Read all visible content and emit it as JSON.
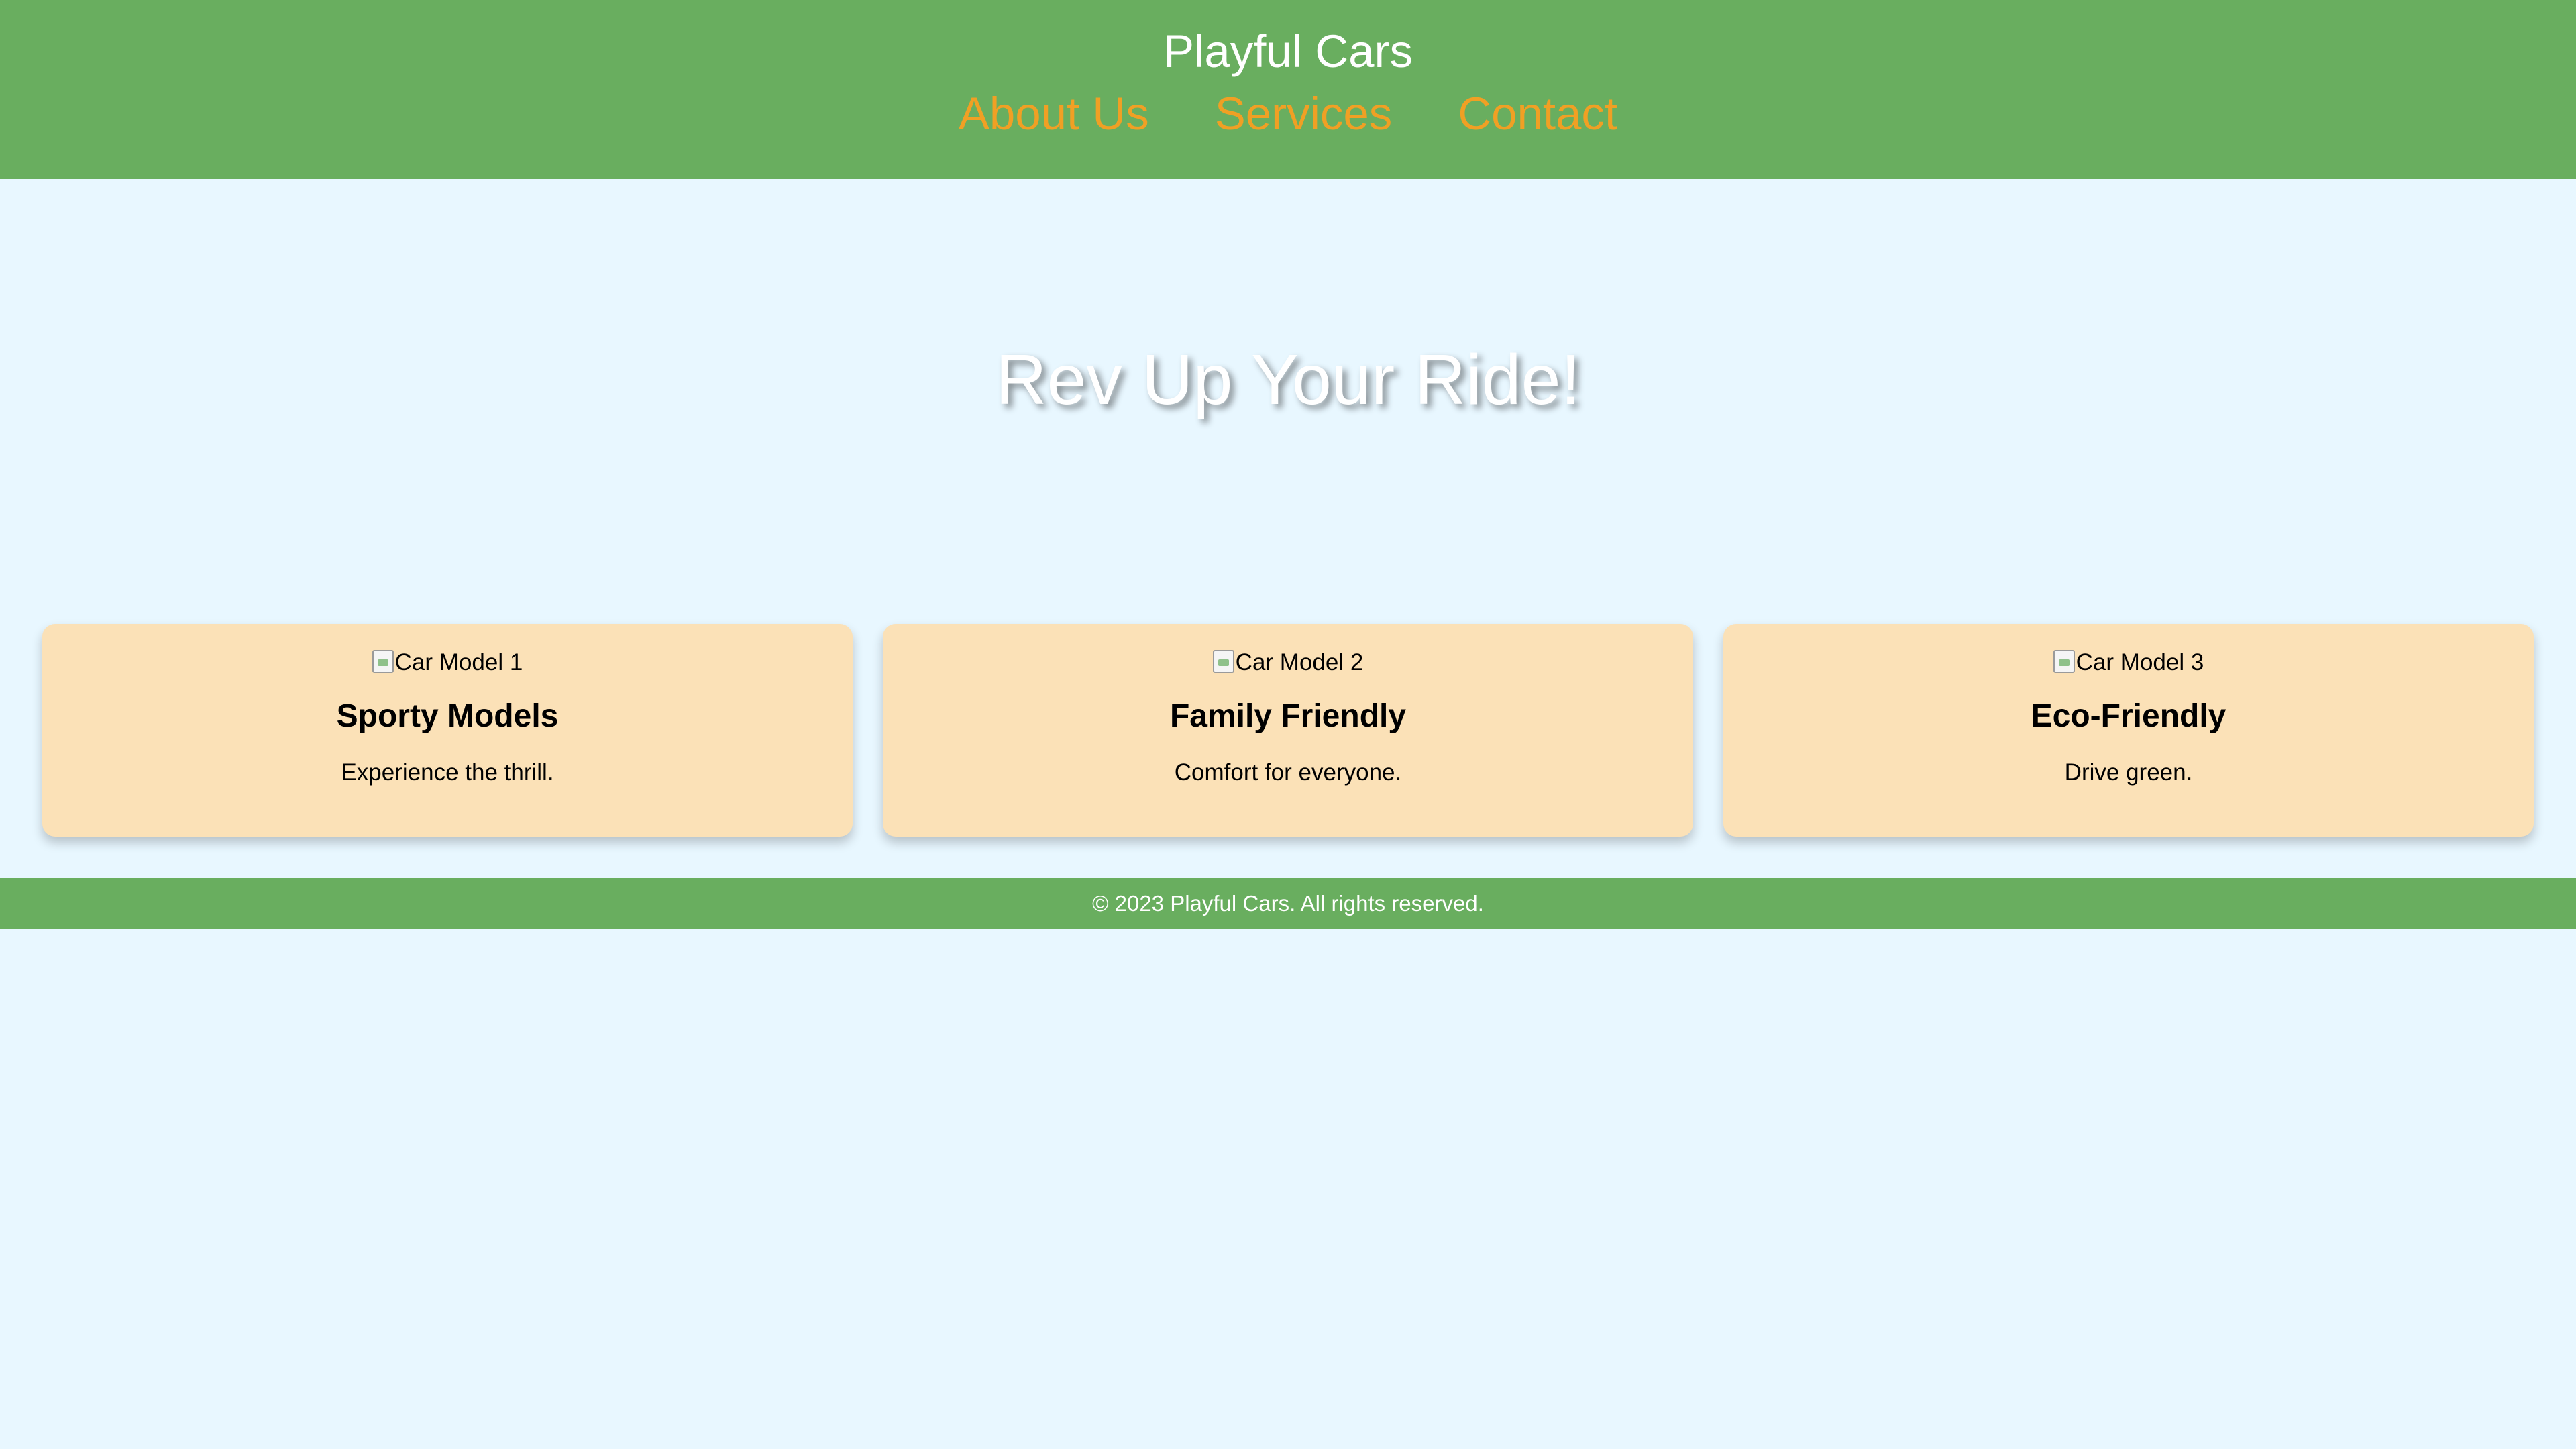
{
  "header": {
    "title": "Playful Cars",
    "nav": [
      {
        "label": "About Us"
      },
      {
        "label": "Services"
      },
      {
        "label": "Contact"
      }
    ]
  },
  "hero": {
    "title": "Rev Up Your Ride!"
  },
  "cards": [
    {
      "image_alt": "Car Model 1",
      "title": "Sporty Models",
      "description": "Experience the thrill."
    },
    {
      "image_alt": "Car Model 2",
      "title": "Family Friendly",
      "description": "Comfort for everyone."
    },
    {
      "image_alt": "Car Model 3",
      "title": "Eco-Friendly",
      "description": "Drive green."
    }
  ],
  "footer": {
    "text": "© 2023 Playful Cars. All rights reserved."
  },
  "colors": {
    "header_bg": "#69ae5f",
    "nav_link": "#f0a024",
    "page_bg": "#e8f7ff",
    "card_bg": "#fbe1b7"
  }
}
